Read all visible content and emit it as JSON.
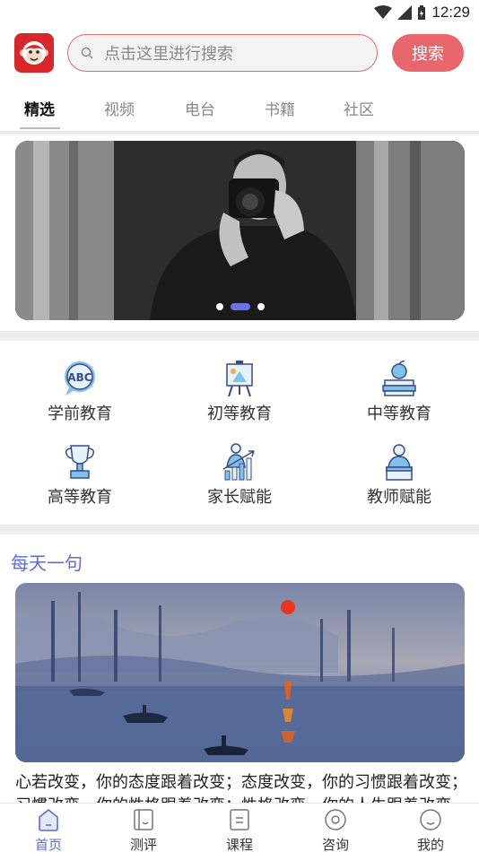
{
  "status_bar": {
    "time": "12:29"
  },
  "header": {
    "search_placeholder": "点击这里进行搜索",
    "search_button": "搜索"
  },
  "tabs": [
    "精选",
    "视频",
    "电台",
    "书籍",
    "社区"
  ],
  "categories": [
    "学前教育",
    "初等教育",
    "中等教育",
    "高等教育",
    "家长赋能",
    "教师赋能"
  ],
  "daily": {
    "title": "每天一句",
    "quote": "心若改变，你的态度跟着改变；态度改变，你的习惯跟着改变；习惯改变，你的性格跟着改变；性格改变，你的人生跟着改变。"
  },
  "bottom_nav": [
    "首页",
    "测评",
    "课程",
    "咨询",
    "我的"
  ],
  "colors": {
    "accent": "#5b6cd9",
    "brand_red": "#e8666c",
    "logo_red": "#d8262b"
  }
}
